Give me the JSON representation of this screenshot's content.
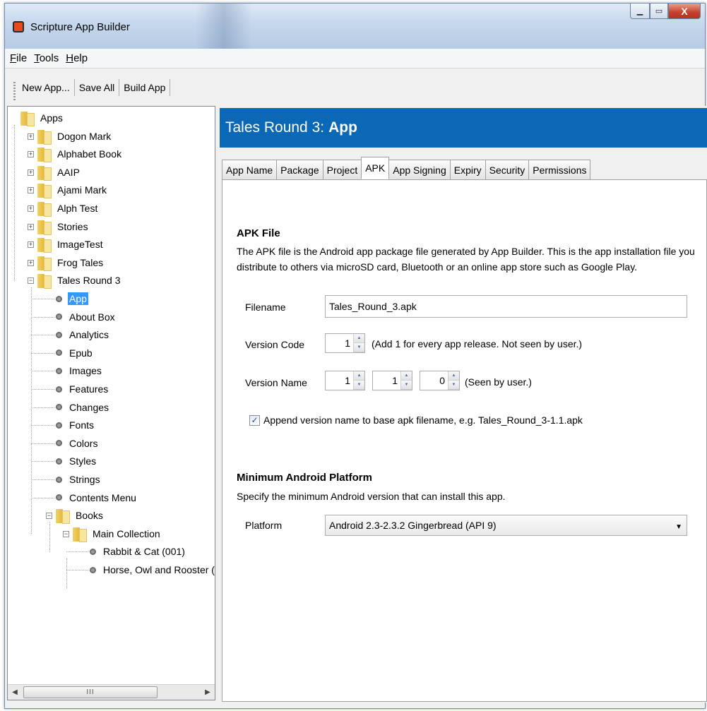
{
  "window": {
    "title": "Scripture App Builder",
    "min_glyph": "▁",
    "max_glyph": "▭",
    "close_glyph": "X"
  },
  "menu": {
    "file": {
      "mnemonic": "F",
      "rest": "ile"
    },
    "tools": {
      "mnemonic": "T",
      "rest": "ools"
    },
    "help": {
      "mnemonic": "H",
      "rest": "elp"
    }
  },
  "toolbar": {
    "new_app": "New App...",
    "save_all": "Save All",
    "build_app": "Build App"
  },
  "tree": {
    "root": "Apps",
    "apps": [
      "Dogon Mark",
      "Alphabet Book",
      "AAIP",
      "Ajami Mark",
      "Alph Test",
      "Stories",
      "ImageTest",
      "Frog Tales"
    ],
    "current_app": "Tales Round 3",
    "app_pages": [
      "App",
      "About Box",
      "Analytics",
      "Epub",
      "Images",
      "Features",
      "Changes",
      "Fonts",
      "Colors",
      "Styles",
      "Strings",
      "Contents Menu"
    ],
    "books": "Books",
    "collection": "Main Collection",
    "book_items": [
      "Rabbit & Cat (001)",
      "Horse, Owl and Rooster ("
    ],
    "scroll_glyph": "III",
    "left_arrow": "◀",
    "right_arrow": "▶"
  },
  "header": {
    "prefix": "Tales Round 3:",
    "page": "App"
  },
  "tabs": [
    "App Name",
    "Package",
    "Project",
    "APK",
    "App Signing",
    "Expiry",
    "Security",
    "Permissions"
  ],
  "apk": {
    "title": "APK File",
    "description": "The APK file is the Android app package file generated by App Builder. This is the app installation file you distribute to others via microSD card, Bluetooth or an online app store such as Google Play.",
    "filename_label": "Filename",
    "filename_value": "Tales_Round_3.apk",
    "version_code_label": "Version Code",
    "version_code_value": "1",
    "version_code_hint": "(Add 1 for every app release. Not seen by user.)",
    "version_name_label": "Version Name",
    "version_name_major": "1",
    "version_name_minor": "1",
    "version_name_patch": "0",
    "version_name_hint": "(Seen by user.)",
    "append_label": "Append version name to base apk filename, e.g. Tales_Round_3-1.1.apk",
    "append_checked_glyph": "✓"
  },
  "platform": {
    "title": "Minimum Android Platform",
    "description": "Specify the minimum Android version that can install this app.",
    "label": "Platform",
    "selected": "Android 2.3-2.3.2 Gingerbread (API 9)"
  }
}
